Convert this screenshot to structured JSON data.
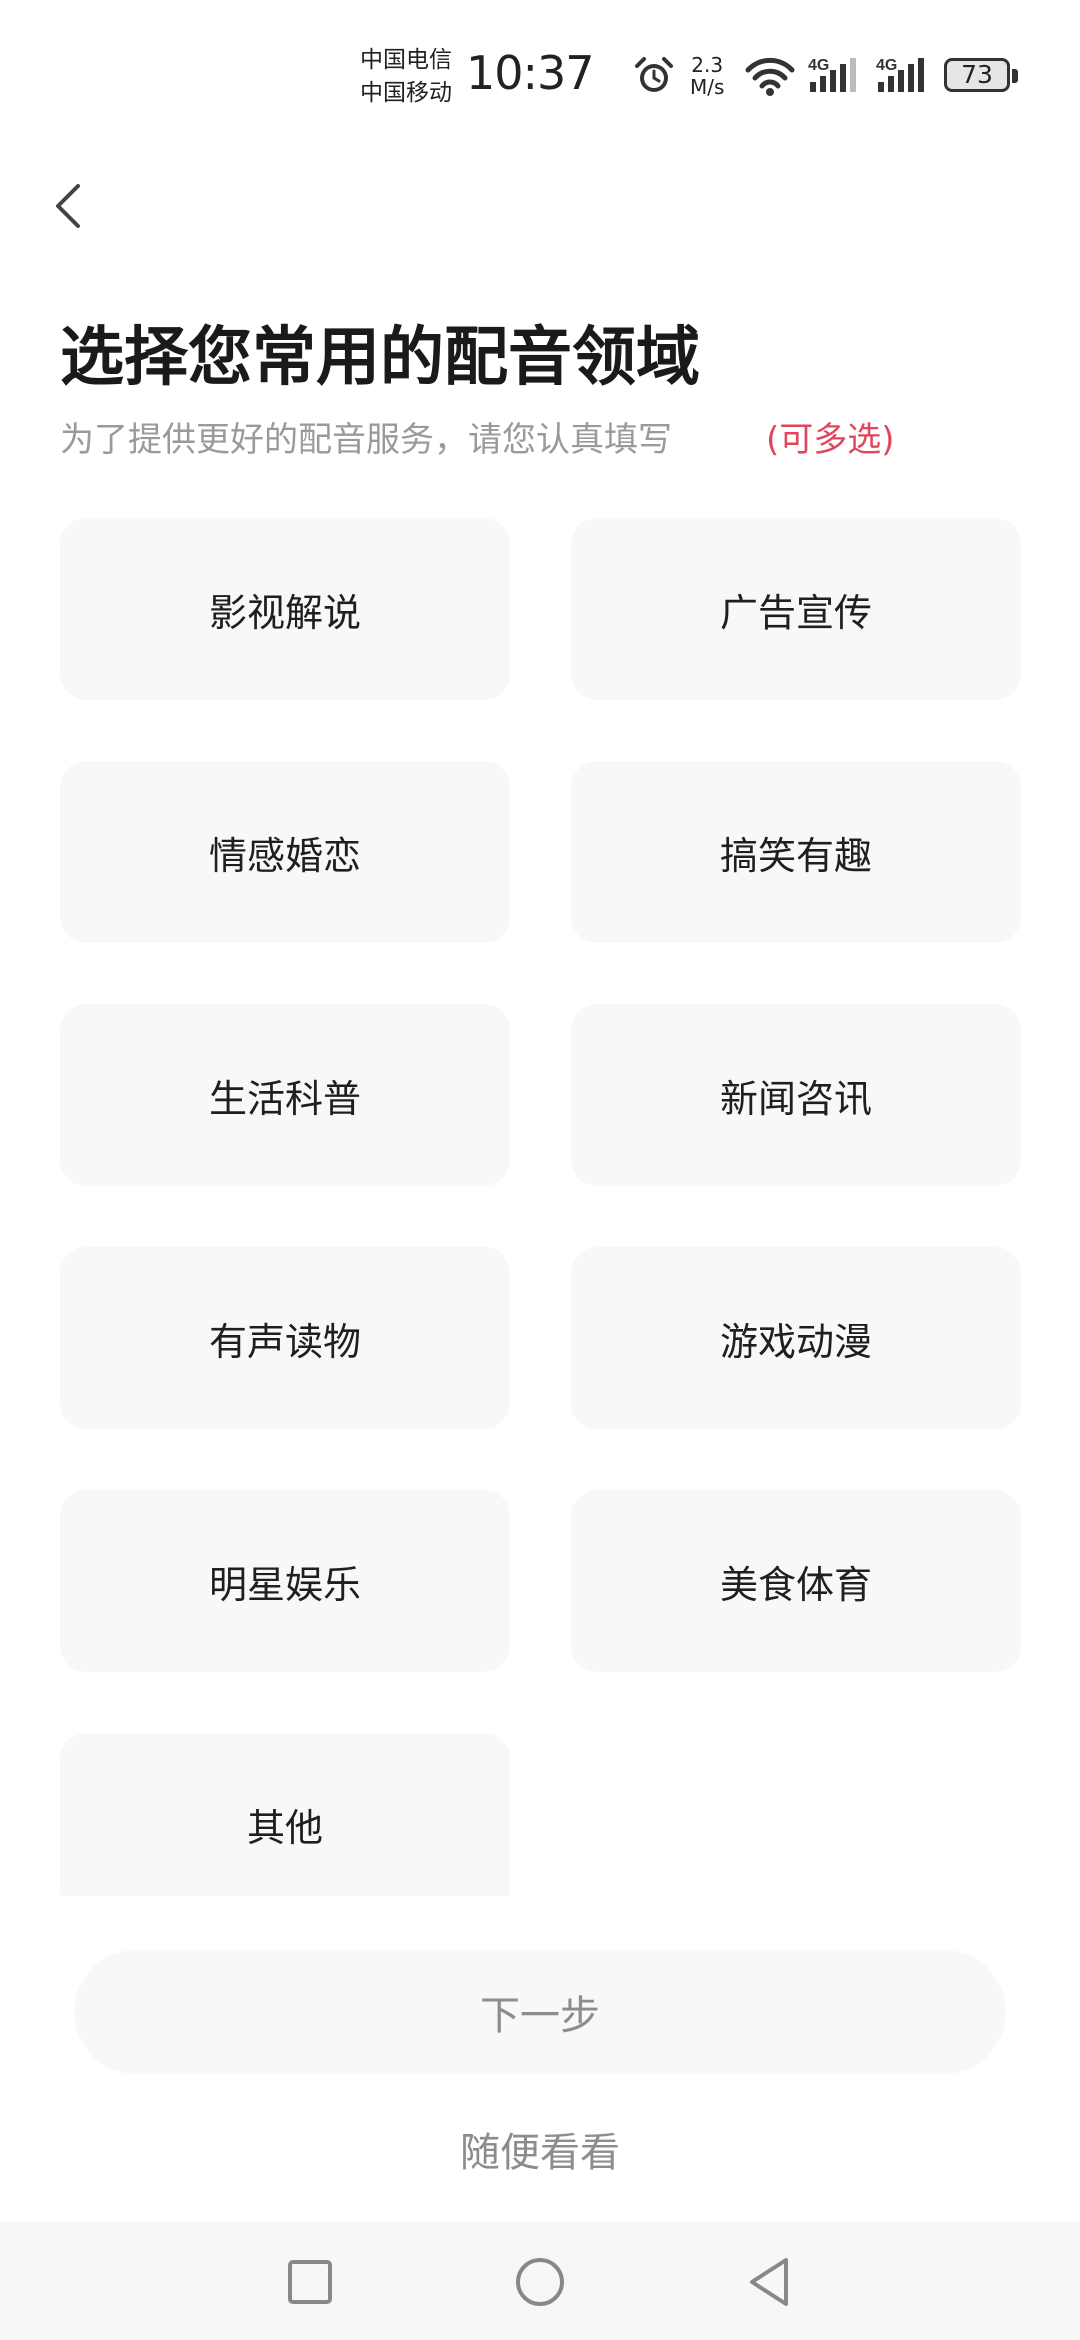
{
  "status_bar": {
    "carrier1": "中国电信",
    "carrier2": "中国移动",
    "time": "10:37",
    "speed_value": "2.3",
    "speed_unit": "M/s",
    "net1": "4G",
    "net2": "4G",
    "battery": "73"
  },
  "header": {
    "title": "选择您常用的配音领域",
    "subtitle": "为了提供更好的配音服务，请您认真填写",
    "multi_hint": "(可多选)"
  },
  "categories": [
    "影视解说",
    "广告宣传",
    "情感婚恋",
    "搞笑有趣",
    "生活科普",
    "新闻咨讯",
    "有声读物",
    "游戏动漫",
    "明星娱乐",
    "美食体育",
    "其他"
  ],
  "actions": {
    "next": "下一步",
    "browse": "随便看看"
  },
  "icons": {
    "back": "chevron-left-icon",
    "alarm": "alarm-icon",
    "wifi": "wifi-icon",
    "signal": "signal-icon",
    "nav_recent": "square-icon",
    "nav_home": "circle-icon",
    "nav_back": "triangle-back-icon"
  },
  "colors": {
    "accent": "#e0475d",
    "tile_bg": "#f7f8fa",
    "muted_text": "#9a9a9a"
  }
}
